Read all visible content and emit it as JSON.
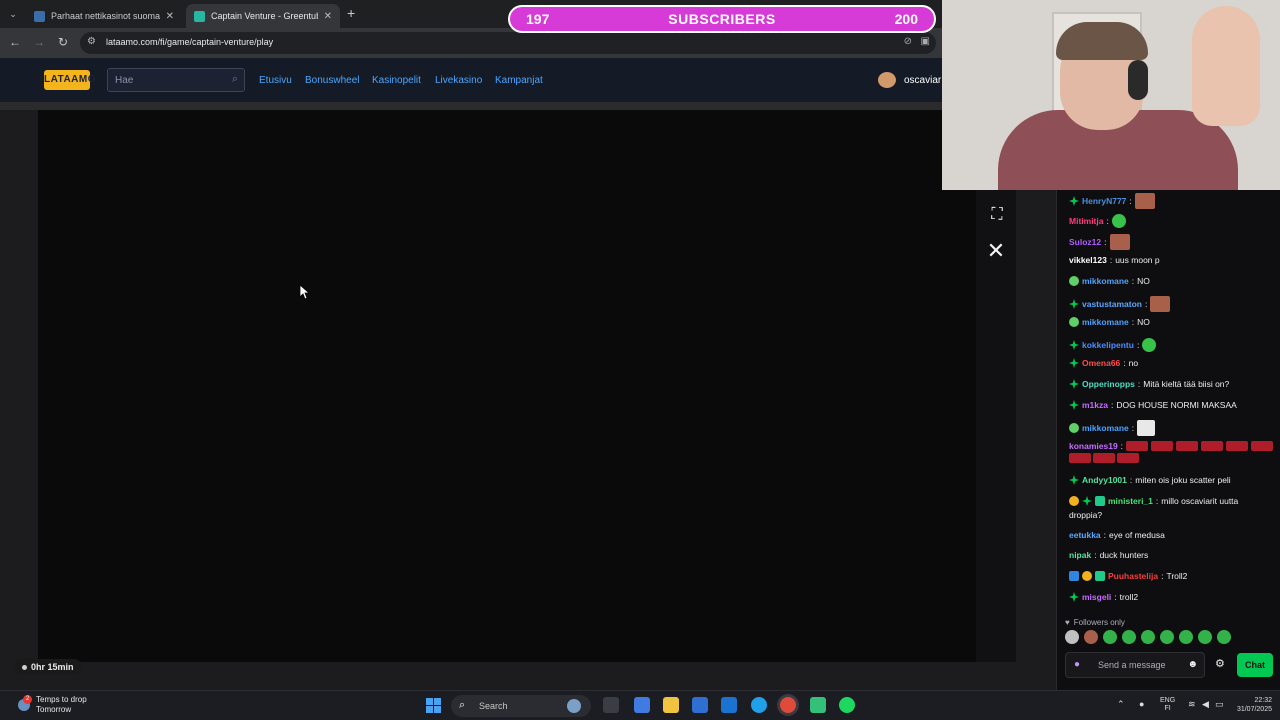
{
  "browser": {
    "tabs": [
      {
        "title": "Parhaat nettikasinot suomalaisille",
        "fav_color": "#3a6ea8",
        "active": false
      },
      {
        "title": "Captain Venture - Greentube - ",
        "fav_color": "#27b6a0",
        "active": true
      }
    ],
    "url": "lataamo.com/fi/game/captain-venture/play"
  },
  "site": {
    "logo": "LATAAMO",
    "search_placeholder": "Hae",
    "nav": [
      "Etusivu",
      "Bonuswheel",
      "Kasinopelit",
      "Livekasino",
      "Kampanjat"
    ],
    "username": "oscaviar"
  },
  "overlay": {
    "sub_current": "197",
    "sub_label": "SUBSCRIBERS",
    "sub_goal": "200",
    "timer": "0hr 15min"
  },
  "chat": {
    "messages": [
      {
        "user": "HenryN777",
        "color": "#4a90e2",
        "text": "",
        "emote": "face",
        "badges": [
          "g"
        ]
      },
      {
        "user": "Mitimitja",
        "color": "#ff3d7f",
        "text": "",
        "emote": "green",
        "badges": []
      },
      {
        "user": "Suloz12",
        "color": "#b05cff",
        "text": "",
        "emote": "face",
        "badges": []
      },
      {
        "user": "vikkel123",
        "color": "#ffffff",
        "text": "uus moon p",
        "emote": "",
        "badges": []
      },
      {
        "user": "mikkomane",
        "color": "#4aa3ff",
        "text": "NO",
        "emote": "",
        "badges": [
          "v"
        ]
      },
      {
        "user": "vastustamaton",
        "color": "#5aa7ff",
        "text": "",
        "emote": "face",
        "badges": [
          "g"
        ]
      },
      {
        "user": "mikkomane",
        "color": "#4aa3ff",
        "text": "NO",
        "emote": "",
        "badges": [
          "v"
        ]
      },
      {
        "user": "kokkelipentu",
        "color": "#4a8cff",
        "text": "",
        "emote": "green",
        "badges": [
          "g"
        ]
      },
      {
        "user": "Omena66",
        "color": "#ff4d4d",
        "text": "no",
        "emote": "",
        "badges": [
          "g"
        ]
      },
      {
        "user": "Opperinopps",
        "color": "#49e0c4",
        "text": "Mitä kieltä tää biisi on?",
        "emote": "",
        "badges": [
          "g"
        ]
      },
      {
        "user": "m1kza",
        "color": "#c86bff",
        "text": "DOG HOUSE NORMI MAKSAA",
        "emote": "",
        "badges": [
          "g"
        ]
      },
      {
        "user": "mikkomane",
        "color": "#4aa3ff",
        "text": "",
        "emote": "white",
        "badges": [
          "v"
        ]
      },
      {
        "user": "konamies19",
        "color": "#c86bff",
        "text": "",
        "emote": "",
        "badges": []
      },
      {
        "user": "Andyy1001",
        "color": "#56e39f",
        "text": "miten ois joku scatter peli",
        "emote": "",
        "badges": [
          "g"
        ]
      },
      {
        "user": "ministeri_1",
        "color": "#4ee07a",
        "text": "millo oscaviarit uutta",
        "emote": "",
        "badges": [
          "gold",
          "g",
          "gift"
        ]
      },
      {
        "user": "",
        "color": "#efeff1",
        "text": "droppia?",
        "emote": "",
        "badges": []
      },
      {
        "user": "eetukka",
        "color": "#5aa7ff",
        "text": "eye of medusa",
        "emote": "",
        "badges": []
      },
      {
        "user": "nipak",
        "color": "#56e39f",
        "text": "duck hunters",
        "emote": "",
        "badges": []
      },
      {
        "user": "Puuhastelija",
        "color": "#ff3b3b",
        "text": "Troll2",
        "emote": "",
        "badges": [
          "blue",
          "gold",
          "gift"
        ]
      },
      {
        "user": "misgeli",
        "color": "#c86bff",
        "text": "troll2",
        "emote": "",
        "badges": [
          "g"
        ]
      }
    ],
    "mode": "Followers only",
    "input_placeholder": "Send a message",
    "chat_button": "Chat"
  },
  "taskbar": {
    "weather_line1": "Temps to drop",
    "weather_line2": "Tomorrow",
    "notif_count": "2",
    "search": "Search",
    "lang_line1": "ENG",
    "lang_line2": "FI",
    "time": "22:32",
    "date": "31/07/2025"
  }
}
